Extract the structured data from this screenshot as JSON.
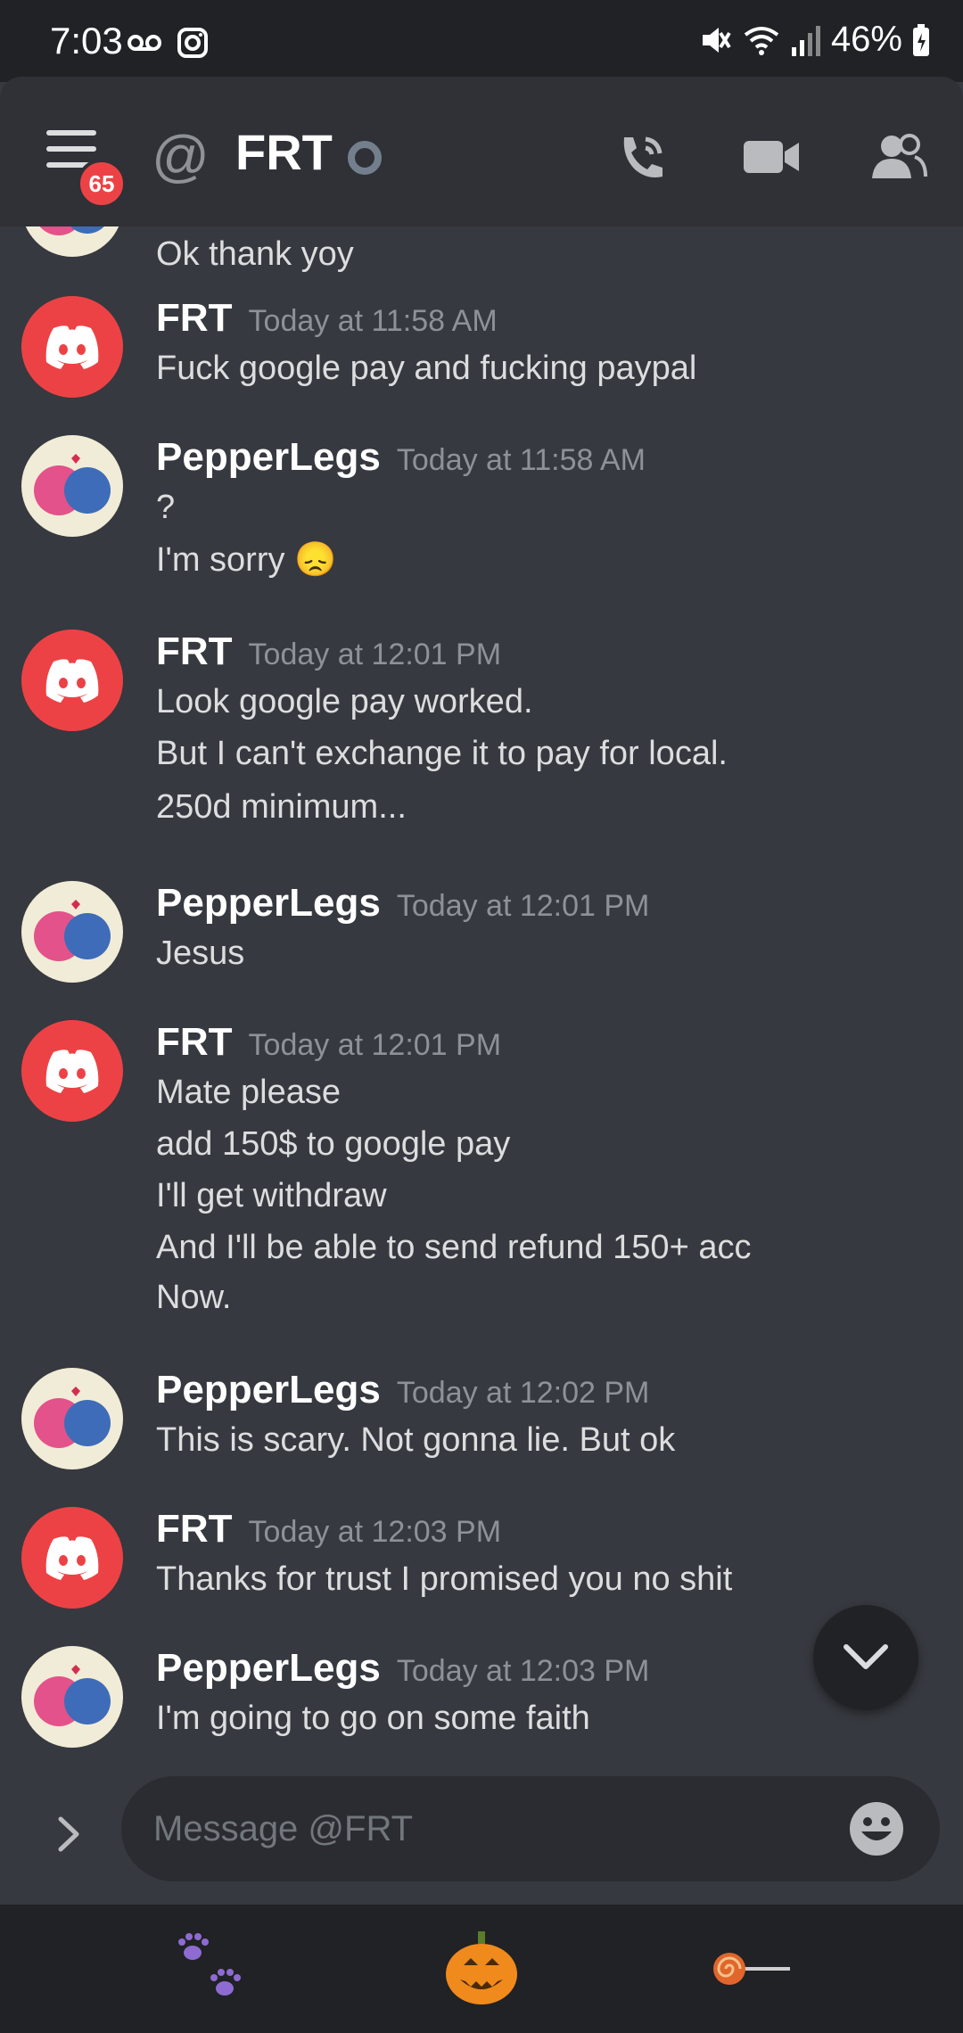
{
  "status_bar": {
    "time": "7:03",
    "battery": "46%"
  },
  "header": {
    "title": "FRT",
    "at_symbol": "@",
    "badge_count": "65"
  },
  "icons": {
    "menu": "menu-icon",
    "call": "phone-call-icon",
    "video": "video-camera-icon",
    "members": "members-icon",
    "voicemail": "voicemail-icon",
    "instagram": "instagram-icon",
    "mute": "mute-icon",
    "wifi": "wifi-icon",
    "signal": "signal-icon",
    "battery": "battery-icon"
  },
  "messages": [
    {
      "author": "",
      "timestamp": "",
      "lines": [
        "Ok thank yoy"
      ]
    },
    {
      "author": "FRT",
      "timestamp": "Today at 11:58 AM",
      "lines": [
        "Fuck google pay and fucking paypal"
      ]
    },
    {
      "author": "PepperLegs",
      "timestamp": "Today at 11:58 AM",
      "lines": [
        "?",
        "I'm sorry 😞"
      ]
    },
    {
      "author": "FRT",
      "timestamp": "Today at 12:01 PM",
      "lines": [
        "Look google pay worked.",
        "But I can't exchange it to pay for local.",
        "250d minimum..."
      ]
    },
    {
      "author": "PepperLegs",
      "timestamp": "Today at 12:01 PM",
      "lines": [
        "Jesus"
      ]
    },
    {
      "author": "FRT",
      "timestamp": "Today at 12:01 PM",
      "lines": [
        "Mate please",
        "add 150$ to google pay",
        "I'll get withdraw",
        "And I'll be able to send refund 150+ acc",
        "Now."
      ]
    },
    {
      "author": "PepperLegs",
      "timestamp": "Today at 12:02 PM",
      "lines": [
        "This is scary. Not gonna lie. But ok"
      ]
    },
    {
      "author": "FRT",
      "timestamp": "Today at 12:03 PM",
      "lines": [
        "Thanks for trust I promised you no shit"
      ]
    },
    {
      "author": "PepperLegs",
      "timestamp": "Today at 12:03 PM",
      "lines": [
        "I'm going to go on some faith"
      ]
    }
  ],
  "composer": {
    "placeholder": "Message @FRT"
  },
  "bottom_nav": [
    {
      "icon": "paw-prints-icon"
    },
    {
      "icon": "jack-o-lantern-icon"
    },
    {
      "icon": "lollipop-icon"
    }
  ],
  "colors": {
    "background": "#36393f",
    "header": "#2f3136",
    "accent_red": "#ed4245",
    "text": "#dcddde",
    "muted": "#8e9297"
  }
}
